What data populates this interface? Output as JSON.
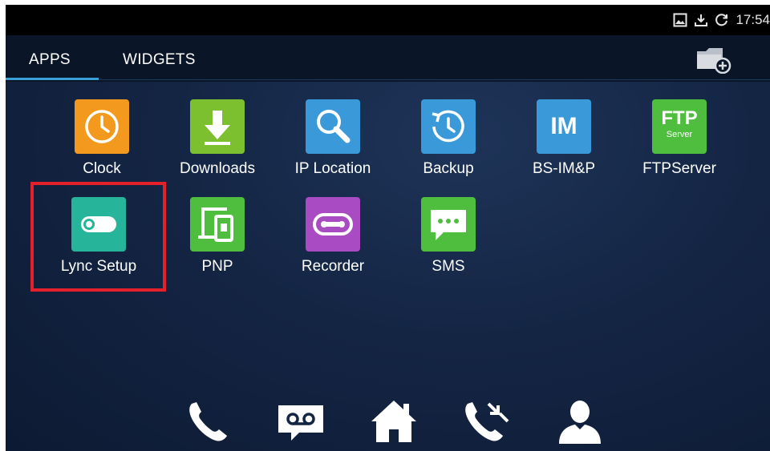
{
  "status": {
    "time": "17:54",
    "icons": [
      "image-icon",
      "download-icon",
      "sync-icon"
    ]
  },
  "tabs": [
    {
      "label": "APPS",
      "active": true
    },
    {
      "label": "WIDGETS",
      "active": false
    }
  ],
  "folder_action": {
    "icon": "folder-add-icon"
  },
  "apps": [
    {
      "label": "Clock",
      "icon": "clock-icon",
      "color": "#f39a1e"
    },
    {
      "label": "Downloads",
      "icon": "download-arrow-icon",
      "color": "#7cbf2f"
    },
    {
      "label": "IP Location",
      "icon": "magnifier-icon",
      "color": "#3a9ad9"
    },
    {
      "label": "Backup",
      "icon": "backup-clock-icon",
      "color": "#3a9ad9"
    },
    {
      "label": "BS-IM&P",
      "icon": "im-icon",
      "text": "IM",
      "color": "#3a9ad9"
    },
    {
      "label": "FTPServer",
      "icon": "ftp-icon",
      "text": "FTP",
      "subtext": "Server",
      "color": "#4fbe3e"
    },
    {
      "label": "Lync Setup",
      "icon": "toggle-icon",
      "color": "#26b59a"
    },
    {
      "label": "PNP",
      "icon": "devices-icon",
      "color": "#4fbe3e"
    },
    {
      "label": "Recorder",
      "icon": "tape-icon",
      "color": "#a94bc2"
    },
    {
      "label": "SMS",
      "icon": "chat-bubble-icon",
      "color": "#4fbe3e"
    }
  ],
  "dock": [
    {
      "icon": "phone-icon"
    },
    {
      "icon": "voicemail-icon"
    },
    {
      "icon": "home-icon"
    },
    {
      "icon": "call-transfer-icon"
    },
    {
      "icon": "contact-icon"
    }
  ]
}
